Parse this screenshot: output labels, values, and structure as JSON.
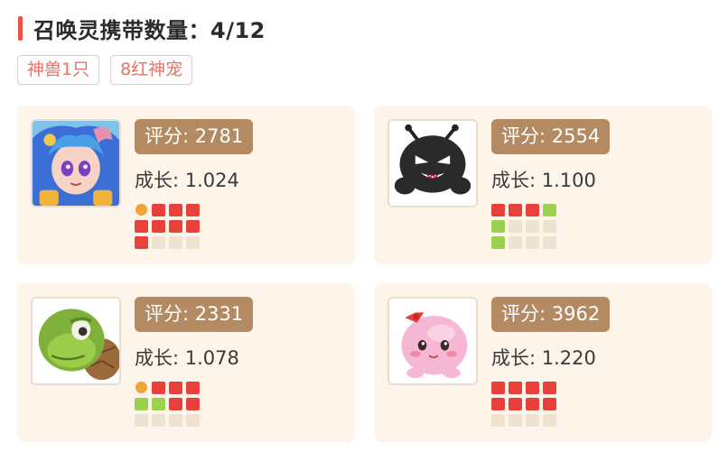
{
  "header": {
    "title": "召唤灵携带数量：4/12"
  },
  "tags": [
    "神兽1只",
    "8红神宠"
  ],
  "colors": {
    "accent": "#e8543f",
    "score_bg": "#b38a62",
    "card_bg": "#fdf5ea"
  },
  "cards": [
    {
      "avatar_icon": "mermaid-avatar-icon",
      "score": "评分: 2781",
      "growth": "成长: 1.024",
      "slots": [
        "orange",
        "red",
        "red",
        "red",
        "red",
        "red",
        "red",
        "red",
        "red",
        "empty",
        "empty",
        "empty"
      ]
    },
    {
      "avatar_icon": "black-ant-avatar-icon",
      "score": "评分: 2554",
      "growth": "成长: 1.100",
      "slots": [
        "red",
        "red",
        "red",
        "green",
        "green",
        "empty",
        "empty",
        "empty",
        "green",
        "empty",
        "empty",
        "empty"
      ]
    },
    {
      "avatar_icon": "turtle-avatar-icon",
      "score": "评分: 2331",
      "growth": "成长: 1.078",
      "slots": [
        "orange",
        "red",
        "red",
        "red",
        "green",
        "green",
        "red",
        "red",
        "empty",
        "empty",
        "empty",
        "empty"
      ]
    },
    {
      "avatar_icon": "pink-bubble-avatar-icon",
      "score": "评分: 3962",
      "growth": "成长: 1.220",
      "slots": [
        "red",
        "red",
        "red",
        "red",
        "red",
        "red",
        "red",
        "red",
        "empty",
        "empty",
        "empty",
        "empty"
      ]
    }
  ]
}
